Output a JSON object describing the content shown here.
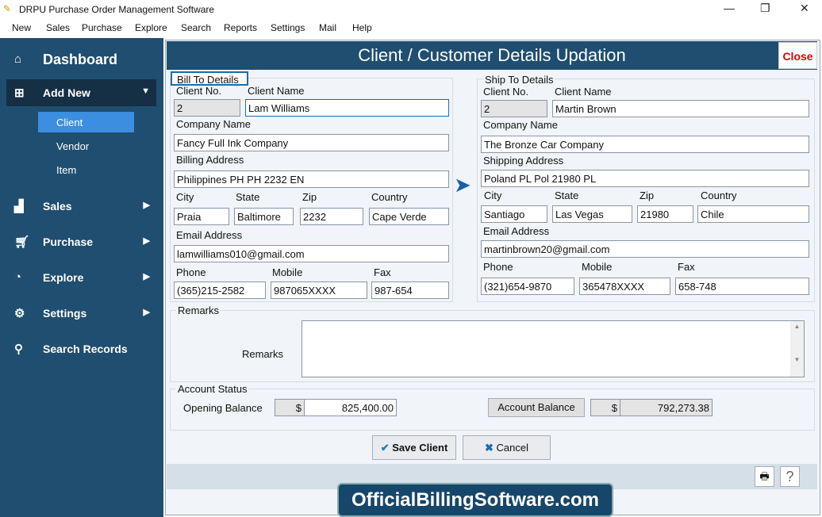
{
  "window": {
    "title": "DRPU Purchase Order Management Software"
  },
  "menu": [
    "New",
    "Sales",
    "Purchase",
    "Explore",
    "Search",
    "Reports",
    "Settings",
    "Mail",
    "Help"
  ],
  "sidebar": {
    "dashboard": "Dashboard",
    "add_new": "Add New",
    "sub_items": [
      "Client",
      "Vendor",
      "Item"
    ],
    "items": [
      "Sales",
      "Purchase",
      "Explore",
      "Settings",
      "Search Records"
    ]
  },
  "header": {
    "title": "Client / Customer Details Updation",
    "close": "Close"
  },
  "labels": {
    "client_no": "Client No.",
    "client_name": "Client Name",
    "company_name": "Company Name",
    "billing_address": "Billing Address",
    "shipping_address": "Shipping Address",
    "city": "City",
    "state": "State",
    "zip": "Zip",
    "country": "Country",
    "email": "Email Address",
    "phone": "Phone",
    "mobile": "Mobile",
    "fax": "Fax",
    "remarks_group": "Remarks",
    "remarks": "Remarks",
    "account_status": "Account Status",
    "opening_balance": "Opening Balance",
    "account_balance": "Account Balance",
    "currency": "$"
  },
  "bill": {
    "title": "Bill To Details",
    "client_no": "2",
    "client_name": "Lam Williams",
    "company": "Fancy Full Ink Company",
    "address": "Philippines PH PH 2232 EN",
    "city": "Praia",
    "state": "Baltimore",
    "zip": "2232",
    "country": "Cape Verde",
    "email": "lamwilliams010@gmail.com",
    "phone": "(365)215-2582",
    "mobile": "987065XXXX",
    "fax": "987-654"
  },
  "ship": {
    "title": "Ship To Details",
    "client_no": "2",
    "client_name": "Martin Brown",
    "company": "The Bronze Car Company",
    "address": "Poland PL Pol 21980 PL",
    "city": "Santiago",
    "state": "Las Vegas",
    "zip": "21980",
    "country": "Chile",
    "email": "martinbrown20@gmail.com",
    "phone": "(321)654-9870",
    "mobile": "365478XXXX",
    "fax": "658-748"
  },
  "account": {
    "opening_balance": "825,400.00",
    "account_balance": "792,273.38"
  },
  "buttons": {
    "save": "Save Client",
    "cancel": "Cancel"
  },
  "watermark": "OfficialBillingSoftware.com"
}
